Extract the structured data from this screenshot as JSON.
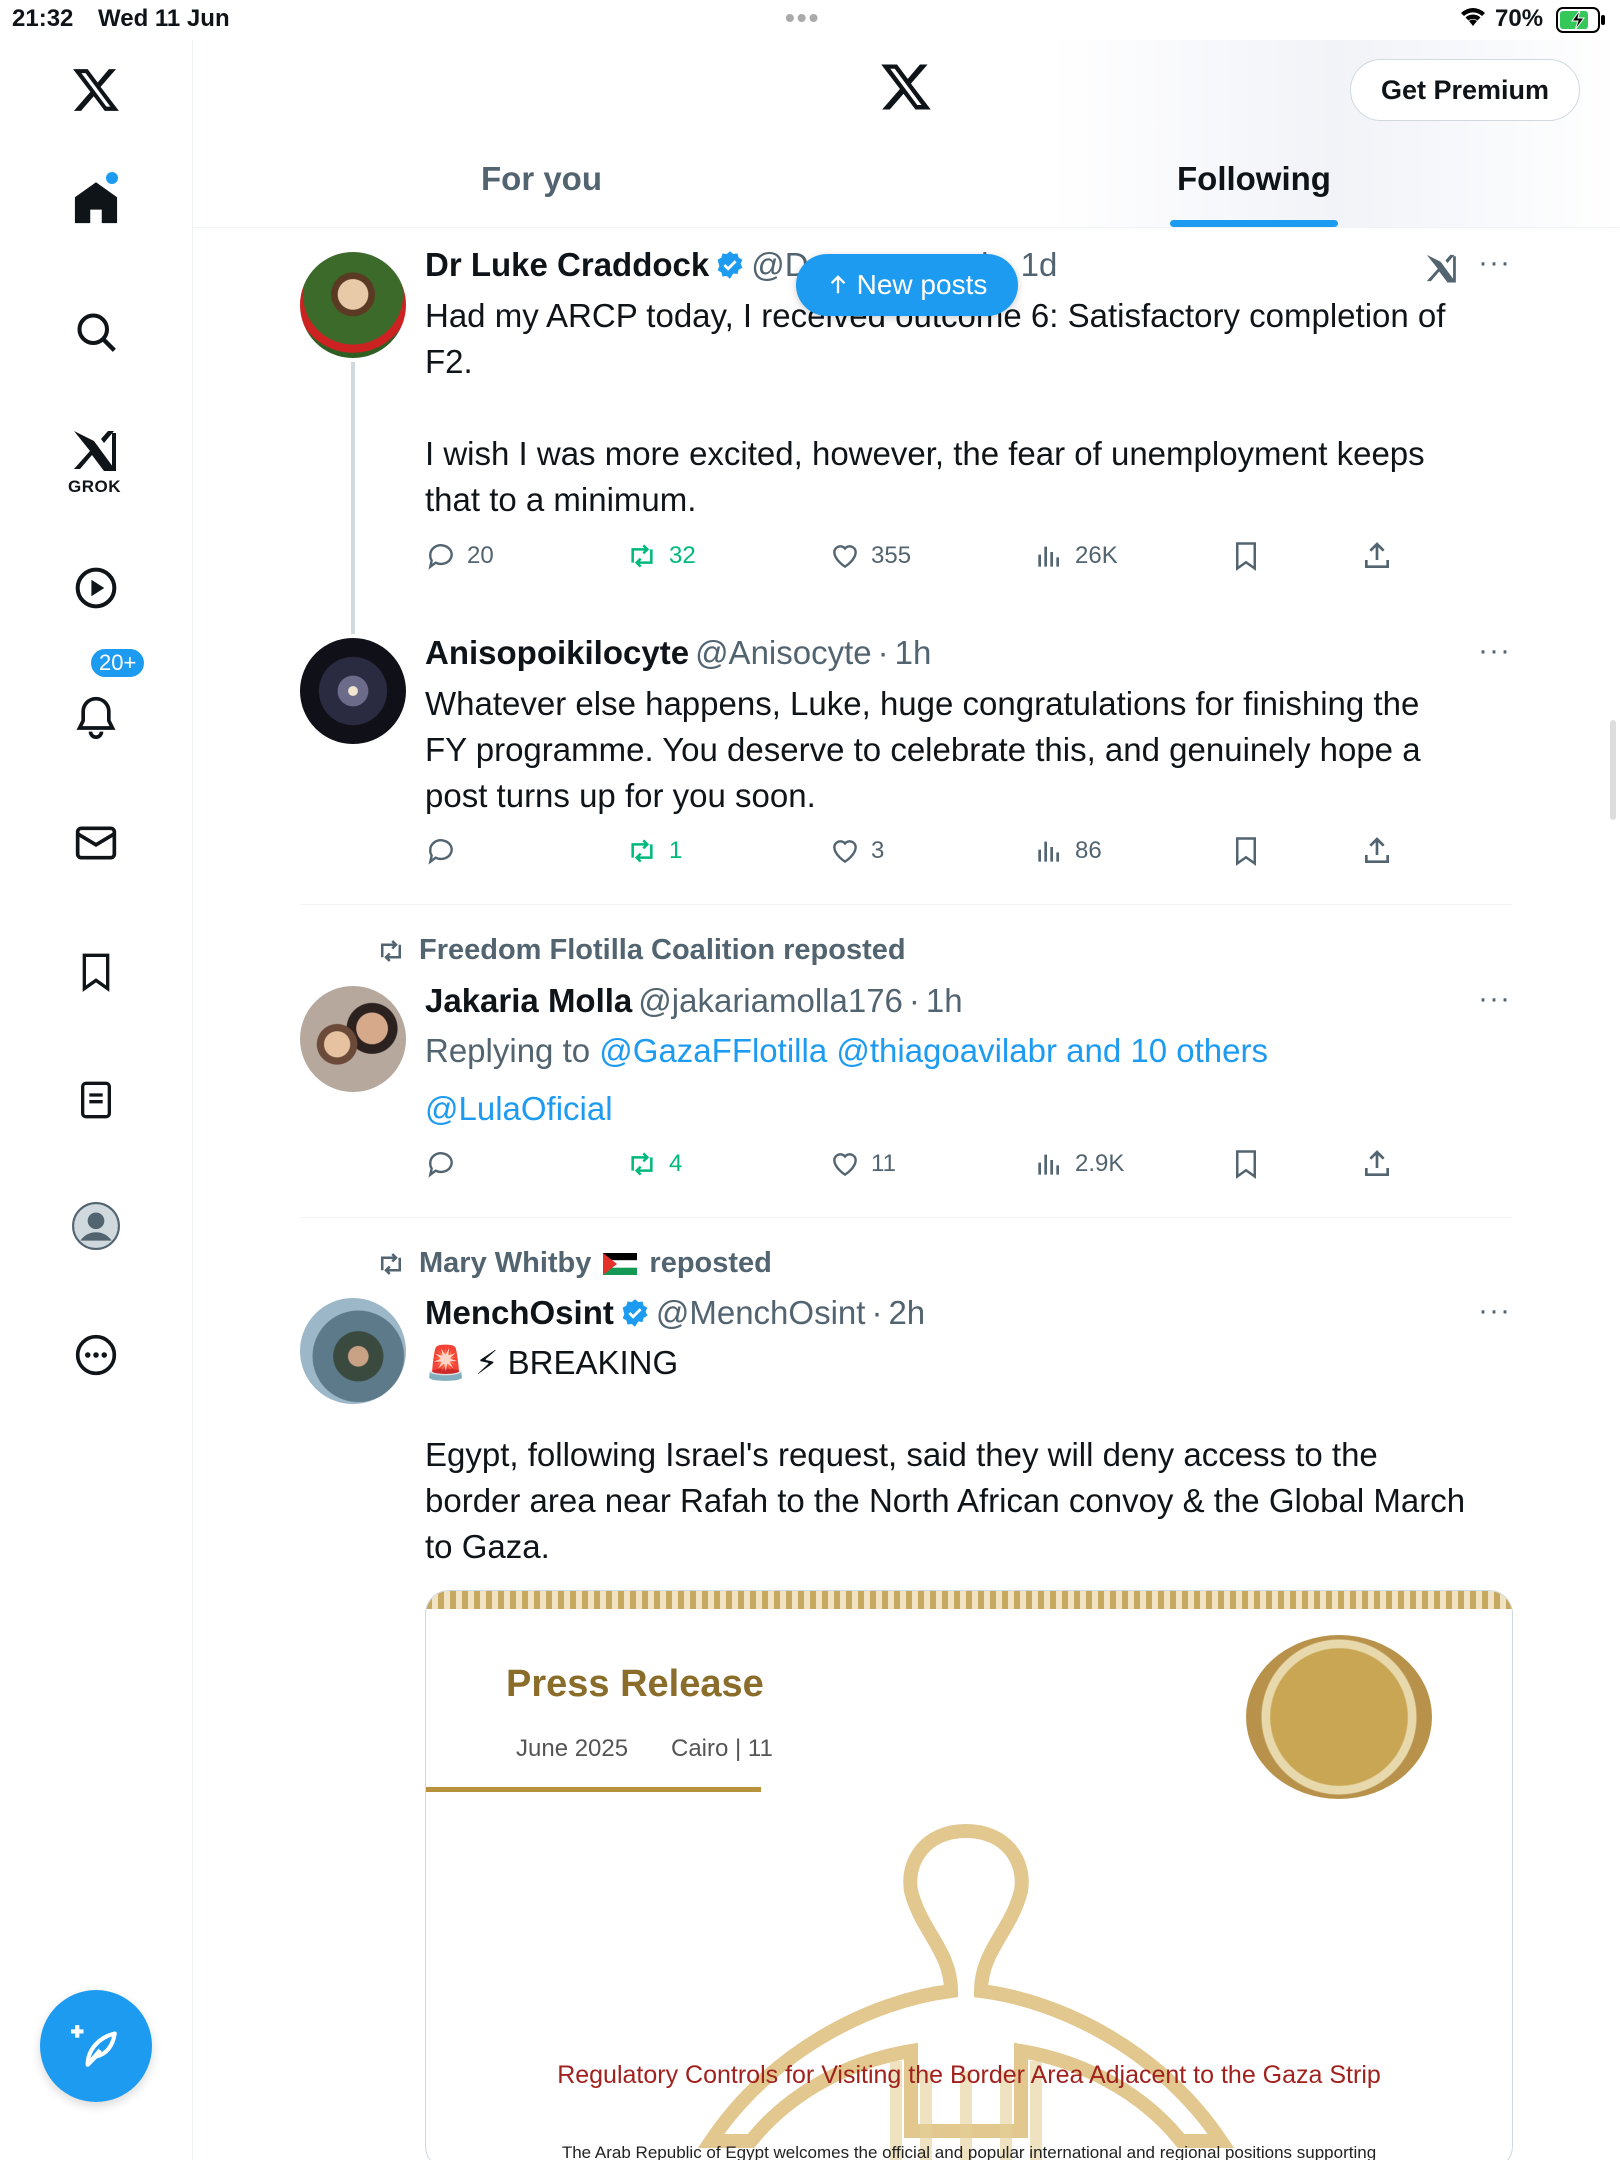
{
  "status": {
    "time": "21:32",
    "date": "Wed 11 Jun",
    "battery": "70%"
  },
  "header": {
    "premium_label": "Get Premium",
    "tabs": [
      "For you",
      "Following"
    ]
  },
  "sidebar": {
    "grok_label": "GROK",
    "notifications_badge": "20+"
  },
  "new_posts_label": "New posts",
  "posts": [
    {
      "name": "Dr Luke Craddock",
      "handle_start": "@D",
      "handle_end": "ck",
      "time": "1d",
      "text": "Had my ARCP today, I received outcome 6: Satisfactory completion of\nF2.\n\nI wish I was more excited, however, the fear of unemployment keeps\nthat to a minimum.",
      "stats": {
        "replies": "20",
        "reposts": "32",
        "likes": "355",
        "views": "26K"
      }
    },
    {
      "name": "Anisopoikilocyte",
      "handle": "@Anisocyte",
      "time": "1h",
      "text": "Whatever else happens, Luke, huge congratulations for finishing the\nFY programme. You deserve to celebrate this, and genuinely hope a\npost turns up for you soon.",
      "stats": {
        "replies": "",
        "reposts": "1",
        "likes": "3",
        "views": "86"
      }
    },
    {
      "reposted_by": "Freedom Flotilla Coalition reposted",
      "name": "Jakaria Molla",
      "handle": "@jakariamolla176",
      "time": "1h",
      "replying_prefix": "Replying to",
      "replying_to": "@GazaFFlotilla @thiagoavilabr and 10 others",
      "text": "@LulaOficial",
      "stats": {
        "replies": "",
        "reposts": "4",
        "likes": "11",
        "views": "2.9K"
      }
    },
    {
      "reposted_by_name": "Mary Whitby",
      "reposted_by_suffix": "reposted",
      "name": "MenchOsint",
      "handle": "@MenchOsint",
      "time": "2h",
      "text_line1": "🚨 ⚡ BREAKING",
      "text": "Egypt, following Israel's request, said they will deny access to the\nborder area near Rafah to the North African convoy & the Global March\nto Gaza.",
      "card": {
        "title": "Press Release",
        "date": "June 2025",
        "city": "Cairo | 11",
        "heading": "Regulatory Controls for Visiting the Border Area Adjacent to the Gaza Strip",
        "text": "The Arab Republic of Egypt welcomes the official and popular international and regional positions supporting"
      }
    }
  ]
}
